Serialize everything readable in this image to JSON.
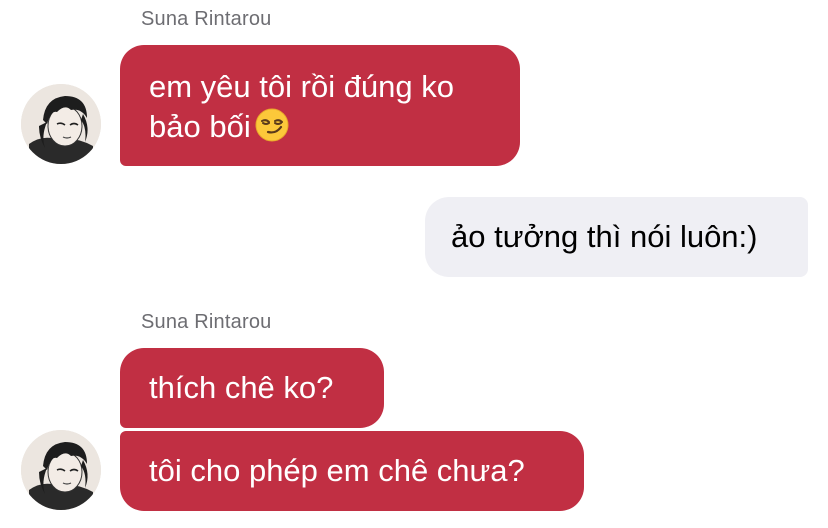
{
  "conversation": {
    "groups": [
      {
        "sender": "Suna Rintarou",
        "messages": [
          "em yêu tôi rồi đúng ko",
          "bảo bối"
        ],
        "emoji": "smirking-face"
      },
      {
        "sender": "me",
        "messages": [
          "ảo tưởng thì nói luôn:)"
        ]
      },
      {
        "sender": "Suna Rintarou",
        "messages": [
          "thích chê ko?",
          "tôi cho phép em chê chưa?"
        ]
      }
    ]
  },
  "colors": {
    "incoming_bubble": "#c12f43",
    "outgoing_bubble": "#efeff4",
    "sender_name": "#6d6d72"
  }
}
